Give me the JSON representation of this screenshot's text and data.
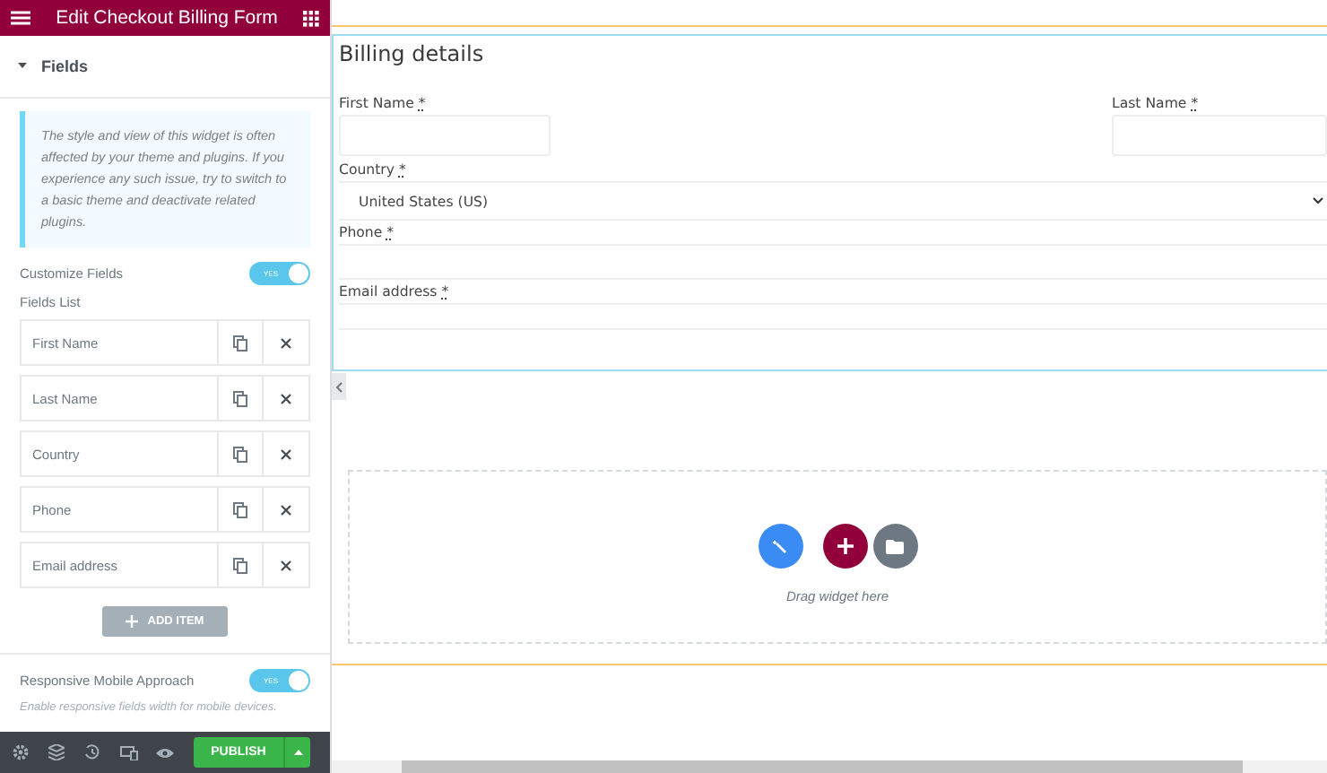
{
  "header": {
    "title": "Edit Checkout Billing Form"
  },
  "section": {
    "title": "Fields",
    "expanded": true
  },
  "notice": "The style and view of this widget is often affected by your theme and plugins. If you experience any such issue, try to switch to a basic theme and deactivate related plugins.",
  "customize": {
    "label": "Customize Fields",
    "toggle_text": "YES",
    "on": true
  },
  "fields_list": {
    "label": "Fields List",
    "items": [
      "First Name",
      "Last Name",
      "Country",
      "Phone",
      "Email address"
    ]
  },
  "add_item": "ADD ITEM",
  "responsive": {
    "label": "Responsive Mobile Approach",
    "toggle_text": "YES",
    "on": true,
    "hint": "Enable responsive fields width for mobile devices."
  },
  "footer": {
    "publish": "PUBLISH"
  },
  "billing": {
    "title": "Billing details",
    "fields": [
      {
        "kind": "half",
        "label": "First Name",
        "required_mark": "*"
      },
      {
        "kind": "half",
        "label": "Last Name",
        "required_mark": "*"
      },
      {
        "kind": "select",
        "label": "Country",
        "required_mark": "*",
        "value": "United States (US)"
      },
      {
        "kind": "text",
        "label": "Phone",
        "required_mark": "*"
      },
      {
        "kind": "text",
        "label": "Email address",
        "required_mark": "*"
      }
    ]
  },
  "dropzone": {
    "hint": "Drag widget here"
  }
}
